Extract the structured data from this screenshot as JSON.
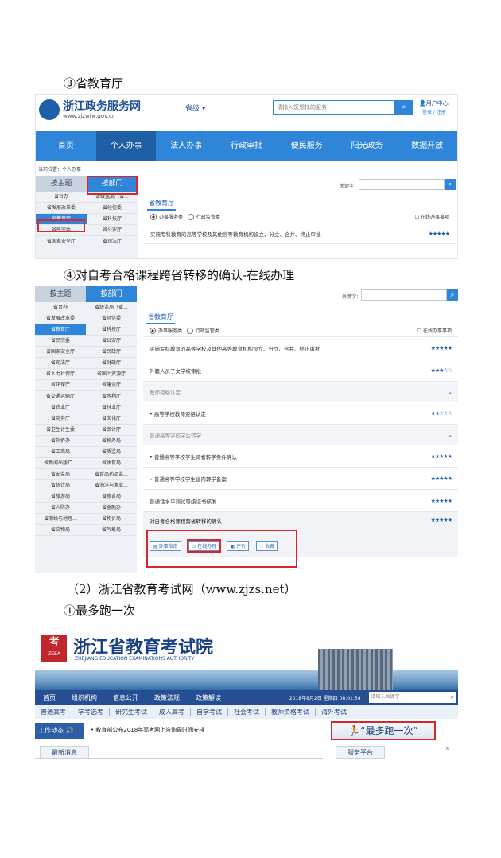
{
  "captions": {
    "c1": "③省教育厅",
    "c2": "④对自考合格课程跨省转移的确认-在线办理",
    "c3": "（2）浙江省教育考试网（www.zjzs.net）",
    "c4": "①最多跑一次"
  },
  "portal": {
    "logo_title": "浙江政务服务网",
    "logo_url": "www.zjzwfw.gov.cn",
    "region": "省级",
    "search_placeholder": "请输入您想找的服务",
    "user_center": "用户中心",
    "user_links": "登录 / 注册",
    "nav": [
      "首页",
      "个人办事",
      "法人办事",
      "行政审批",
      "便民服务",
      "阳光政务",
      "数据开放"
    ],
    "location_label": "当前位置：",
    "location_value": "个人办事",
    "tab_theme": "按主题",
    "tab_dept": "按部门",
    "keyword_label": "关键字：",
    "dept_title": "省教育厅",
    "radio_personal": "办事服务类",
    "radio_admin": "行政监管类",
    "online_only": "在线办事事项",
    "depts1": [
      "省台办",
      "省级监局（省...",
      "省发展改革委",
      "省经信委",
      "省教育厅",
      "省科技厅",
      "省民宗委",
      "省公安厅",
      "省国家安全厅",
      "省司法厅"
    ],
    "depts2": [
      "省台办",
      "省级监局（省...",
      "省发展改革委",
      "省经信委",
      "省教育厅",
      "省科技厅",
      "省民宗委",
      "省公安厅",
      "省国家安全厅",
      "省民政厅",
      "省司法厅",
      "省财政厅",
      "省人力社保厅",
      "省国土资源厅",
      "省环保厅",
      "省建设厅",
      "省交通运输厅",
      "省水利厅",
      "省农业厅",
      "省林业厅",
      "省商务厅",
      "省文化厅",
      "省卫生计生委",
      "省审计厅",
      "省外侨办",
      "省税务局",
      "省工商局",
      "省质监局",
      "省新闻出版广...",
      "省体育局",
      "省安监局",
      "省食品药品监...",
      "省统计局",
      "省海洋与渔业...",
      "省旅游局",
      "省粮食局",
      "省人防办",
      "省金融办",
      "省测绘与地理...",
      "省物价局",
      "省文物局",
      "省气象局"
    ],
    "services1": [
      {
        "name": "实施专科教育的高等学校及其他高等教育机构设立、分立、合并、终止审批",
        "stars": "★★★★★"
      }
    ],
    "services2": [
      {
        "name": "实施专科教育的高等学校及其他高等教育机构设立、分立、合并、终止审批",
        "stars": "★★★★★"
      },
      {
        "name": "外籍人员子女学校审批",
        "stars": "★★★☆☆"
      },
      {
        "name": "教师资格认定",
        "stars": "⌄",
        "grey": true
      },
      {
        "name": "• 高等学校教师资格认定",
        "stars": "★★☆☆☆"
      },
      {
        "name": "普通高等学校学生转学",
        "stars": "⌄",
        "grey": true
      },
      {
        "name": "• 普通高等学校学生跨省转学条件确认",
        "stars": "★★★★★"
      },
      {
        "name": "• 普通高等学校学生省内转学备案",
        "stars": "★★★★★"
      },
      {
        "name": "普通话水平测试等级证书核发",
        "stars": "★★★★★"
      }
    ],
    "target_service": "对自考合格课程跨省转移的确认",
    "target_stars": "★★★★★",
    "target_buttons": [
      "办事指南",
      "在线办理",
      "评价",
      "收藏"
    ]
  },
  "exam": {
    "logo_char": "考",
    "logo_abbr": "ZEEA",
    "title": "浙江省教育考试院",
    "subtitle": "ZHEJIANG EDUCATION EXAMINATIONS AUTHORITY",
    "nav": [
      "首页",
      "组织机构",
      "信息公开",
      "政策法规",
      "政策解读"
    ],
    "date": "2018年8月2日 星期四 08:01:54",
    "search_placeholder": "请输入关键字",
    "subnav": [
      "普通高考",
      "学考选考",
      "研究生考试",
      "成人高考",
      "自学考试",
      "社会考试",
      "教师资格考试",
      "海外考试"
    ],
    "work_label": "工作动态",
    "news_item": "教育部公布2018年高考网上咨询周时间安排",
    "banner": "“最多跑一次”",
    "latest": "最新消息",
    "service_platform": "服务平台",
    "more": "»"
  }
}
